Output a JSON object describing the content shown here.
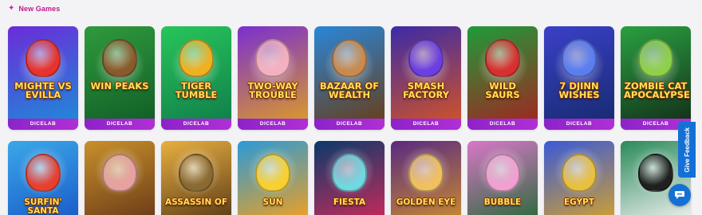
{
  "section": {
    "title": "New Games",
    "icon": "sparkle-icon"
  },
  "games": [
    {
      "title": "Mighte vs Evilla",
      "provider": "DICELAB",
      "bg1": "#6c2bd9",
      "bg2": "#1a8fd8",
      "accent": "#e8322b"
    },
    {
      "title": "Win Peaks",
      "provider": "DICELAB",
      "bg1": "#2f9a3c",
      "bg2": "#0f5b26",
      "accent": "#8a5a2b"
    },
    {
      "title": "Tiger Tumble",
      "provider": "DICELAB",
      "bg1": "#27c55a",
      "bg2": "#0f7b4a",
      "accent": "#f0b020"
    },
    {
      "title": "Two-Way Trouble",
      "provider": "DICELAB",
      "bg1": "#7a2fd0",
      "bg2": "#e0a020",
      "accent": "#f4b0c0"
    },
    {
      "title": "Bazaar of Wealth",
      "provider": "DICELAB",
      "bg1": "#2a86d8",
      "bg2": "#6a3a10",
      "accent": "#c88a50"
    },
    {
      "title": "Smash Factory",
      "provider": "DICELAB",
      "bg1": "#3b2aa8",
      "bg2": "#d85520",
      "accent": "#6b3fe0"
    },
    {
      "title": "Wild Saurs",
      "provider": "DICELAB",
      "bg1": "#1f9a3a",
      "bg2": "#a82020",
      "accent": "#d83030"
    },
    {
      "title": "7 Djinn Wishes",
      "provider": "DICELAB",
      "bg1": "#3a40c8",
      "bg2": "#152a6a",
      "accent": "#5a7df0"
    },
    {
      "title": "Zombie Cat Apocalypse",
      "provider": "DICELAB",
      "bg1": "#2aa040",
      "bg2": "#122a18",
      "accent": "#8fd04a"
    },
    {
      "title": "Surfin' Santa",
      "provider": "",
      "bg1": "#3aa8e8",
      "bg2": "#1a5ac8",
      "accent": "#e84030"
    },
    {
      "title": "",
      "provider": "",
      "bg1": "#c8902a",
      "bg2": "#6a3a18",
      "accent": "#e8a0a0"
    },
    {
      "title": "Assassin of",
      "provider": "",
      "bg1": "#e8b040",
      "bg2": "#5a3a18",
      "accent": "#8a6a30"
    },
    {
      "title": "Sun",
      "provider": "",
      "bg1": "#2a9ad8",
      "bg2": "#f0a020",
      "accent": "#f8d030"
    },
    {
      "title": "Fiesta",
      "provider": "",
      "bg1": "#0a3a6a",
      "bg2": "#c82a5a",
      "accent": "#70d8e0"
    },
    {
      "title": "Golden Eye",
      "provider": "",
      "bg1": "#5a2a80",
      "bg2": "#c88a30",
      "accent": "#f0c060"
    },
    {
      "title": "Bubble",
      "provider": "",
      "bg1": "#d878c8",
      "bg2": "#2a6a3a",
      "accent": "#f0a0d0"
    },
    {
      "title": "Egypt",
      "provider": "",
      "bg1": "#3a5ad8",
      "bg2": "#d0a030",
      "accent": "#e8c040"
    },
    {
      "title": "",
      "provider": "",
      "bg1": "#2a8a5a",
      "bg2": "#f0f0f0",
      "accent": "#202020"
    }
  ],
  "feedback": {
    "label": "Give Feedback"
  },
  "chat": {
    "icon": "chat-icon"
  }
}
